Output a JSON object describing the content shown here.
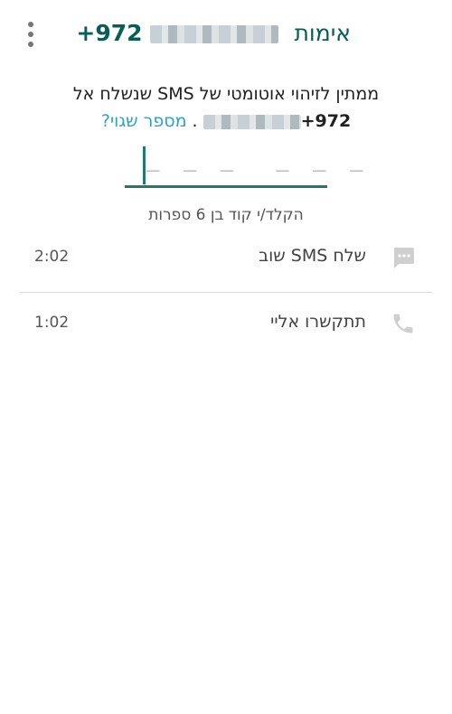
{
  "header": {
    "title": "אימות",
    "phone_prefix": "+972",
    "menu_icon": "more-vert-icon"
  },
  "description": {
    "line1": "ממתין לזיהוי אוטומטי של SMS שנשלח אל",
    "phone_prefix": "+972",
    "wrong_number": "מספר שגוי?"
  },
  "code_input": {
    "slots": "— — —  — — —"
  },
  "hint": "הקלד/י קוד בן 6 ספרות",
  "actions": [
    {
      "label": "שלח SMS שוב",
      "timer": "2:02",
      "icon": "message-icon"
    },
    {
      "label": "תתקשרו אליי",
      "timer": "1:02",
      "icon": "phone-icon"
    }
  ],
  "colors": {
    "brand": "#075e54",
    "accent": "#1f7a6c",
    "link": "#2aa5c8",
    "icon": "#bdbdbd"
  }
}
